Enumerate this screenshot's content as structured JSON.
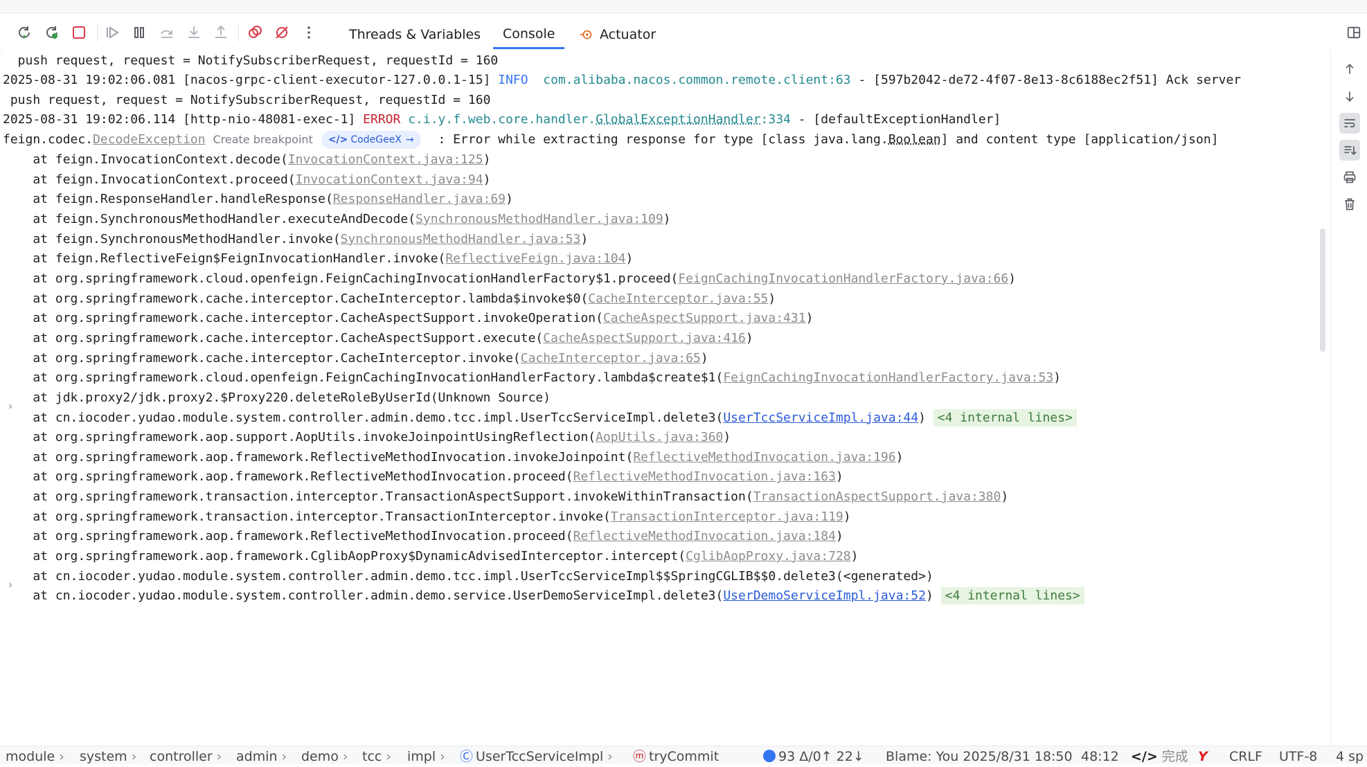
{
  "toolbar": {
    "tabs": [
      {
        "label": "Threads & Variables"
      },
      {
        "label": "Console"
      },
      {
        "label": "Actuator"
      }
    ],
    "active_tab": "Console"
  },
  "console": {
    "l1": {
      "text": "  push request, request = NotifySubscriberRequest, requestId = 160"
    },
    "l2": {
      "ts": "2025-08-31 19:02:06.081 [nacos-grpc-client-executor-127.0.0.1-15] ",
      "level": "INFO",
      "logger": "  com.alibaba.nacos.common.remote.client:63",
      "rest": " - [597b2042-de72-4f07-8e13-8c6188ec2f51] Ack server"
    },
    "l3": {
      "text": " push request, request = NotifySubscriberRequest, requestId = 160"
    },
    "l4": {
      "ts": "2025-08-31 19:02:06.114 [http-nio-48081-exec-1] ",
      "level": "ERROR",
      "logger_a": " c.i.y.f.web.core.handler.",
      "logger_b": "GlobalExceptionHandler",
      "logger_c": ":334",
      "rest": " - [defaultExceptionHandler]"
    },
    "l5": {
      "pre": "feign.codec.",
      "cls": "DecodeException",
      "hint": "Create breakpoint",
      "codegeex": "CodeGeeX",
      "rest_a": " : Error while extracting response for type [class java.lang.",
      "bool": "Boolean",
      "rest_b": "] and content type [application/json]"
    },
    "frames": [
      {
        "pre": "    at feign.InvocationContext.decode(",
        "link": "InvocationContext.java:125",
        "post": ")"
      },
      {
        "pre": "    at feign.InvocationContext.proceed(",
        "link": "InvocationContext.java:94",
        "post": ")"
      },
      {
        "pre": "    at feign.ResponseHandler.handleResponse(",
        "link": "ResponseHandler.java:69",
        "post": ")"
      },
      {
        "pre": "    at feign.SynchronousMethodHandler.executeAndDecode(",
        "link": "SynchronousMethodHandler.java:109",
        "post": ")"
      },
      {
        "pre": "    at feign.SynchronousMethodHandler.invoke(",
        "link": "SynchronousMethodHandler.java:53",
        "post": ")"
      },
      {
        "pre": "    at feign.ReflectiveFeign$FeignInvocationHandler.invoke(",
        "link": "ReflectiveFeign.java:104",
        "post": ")"
      },
      {
        "pre": "    at org.springframework.cloud.openfeign.FeignCachingInvocationHandlerFactory$1.proceed(",
        "link": "FeignCachingInvocationHandlerFactory.java:66",
        "post": ")"
      },
      {
        "pre": "    at org.springframework.cache.interceptor.CacheInterceptor.lambda$invoke$0(",
        "link": "CacheInterceptor.java:55",
        "post": ")"
      },
      {
        "pre": "    at org.springframework.cache.interceptor.CacheAspectSupport.invokeOperation(",
        "link": "CacheAspectSupport.java:431",
        "post": ")"
      },
      {
        "pre": "    at org.springframework.cache.interceptor.CacheAspectSupport.execute(",
        "link": "CacheAspectSupport.java:416",
        "post": ")"
      },
      {
        "pre": "    at org.springframework.cache.interceptor.CacheInterceptor.invoke(",
        "link": "CacheInterceptor.java:65",
        "post": ")"
      },
      {
        "pre": "    at org.springframework.cloud.openfeign.FeignCachingInvocationHandlerFactory.lambda$create$1(",
        "link": "FeignCachingInvocationHandlerFactory.java:53",
        "post": ")"
      },
      {
        "pre": "    at jdk.proxy2/jdk.proxy2.$Proxy220.deleteRoleByUserId(Unknown Source)",
        "link": "",
        "post": ""
      },
      {
        "pre": "    at cn.iocoder.yudao.module.system.controller.admin.demo.tcc.impl.UserTccServiceImpl.delete3(",
        "link": "UserTccServiceImpl.java:44",
        "post": ") ",
        "internal": "<4 internal lines>",
        "own": true
      },
      {
        "pre": "    at org.springframework.aop.support.AopUtils.invokeJoinpointUsingReflection(",
        "link": "AopUtils.java:360",
        "post": ")"
      },
      {
        "pre": "    at org.springframework.aop.framework.ReflectiveMethodInvocation.invokeJoinpoint(",
        "link": "ReflectiveMethodInvocation.java:196",
        "post": ")"
      },
      {
        "pre": "    at org.springframework.aop.framework.ReflectiveMethodInvocation.proceed(",
        "link": "ReflectiveMethodInvocation.java:163",
        "post": ")"
      },
      {
        "pre": "    at org.springframework.transaction.interceptor.TransactionAspectSupport.invokeWithinTransaction(",
        "link": "TransactionAspectSupport.java:380",
        "post": ")"
      },
      {
        "pre": "    at org.springframework.transaction.interceptor.TransactionInterceptor.invoke(",
        "link": "TransactionInterceptor.java:119",
        "post": ")"
      },
      {
        "pre": "    at org.springframework.aop.framework.ReflectiveMethodInvocation.proceed(",
        "link": "ReflectiveMethodInvocation.java:184",
        "post": ")"
      },
      {
        "pre": "    at org.springframework.aop.framework.CglibAopProxy$DynamicAdvisedInterceptor.intercept(",
        "link": "CglibAopProxy.java:728",
        "post": ")"
      },
      {
        "pre": "    at cn.iocoder.yudao.module.system.controller.admin.demo.tcc.impl.UserTccServiceImpl$$SpringCGLIB$$0.delete3(<generated>)",
        "link": "",
        "post": ""
      },
      {
        "pre": "    at cn.iocoder.yudao.module.system.controller.admin.demo.service.UserDemoServiceImpl.delete3(",
        "link": "UserDemoServiceImpl.java:52",
        "post": ") ",
        "internal": "<4 internal lines>",
        "own": true
      }
    ]
  },
  "statusbar": {
    "breadcrumb": [
      "module",
      "system",
      "controller",
      "admin",
      "demo",
      "tcc",
      "impl",
      "UserTccServiceImpl",
      "tryCommit"
    ],
    "vcs": "93 Δ/0↑ 22↓",
    "blame": "Blame: You 2025/8/31 18:50",
    "position": "48:12",
    "ai_status": "完成",
    "line_sep": "CRLF",
    "encoding": "UTF-8",
    "indent": "4 sp"
  },
  "colors": {
    "accent": "#3574f0",
    "error": "#c7222d",
    "info": "#3574f0",
    "logger": "#248a91",
    "internal_bg": "#e6f4e1"
  }
}
